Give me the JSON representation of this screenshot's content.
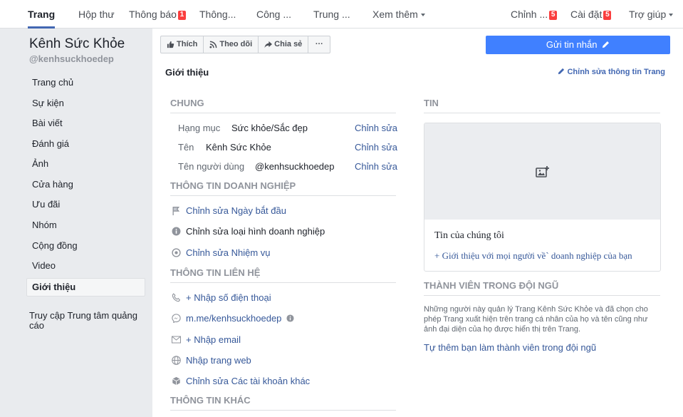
{
  "topnav": {
    "items": [
      {
        "label": "Trang",
        "badge": ""
      },
      {
        "label": "Hộp thư",
        "badge": ""
      },
      {
        "label": "Thông báo",
        "badge": "1"
      },
      {
        "label": "Thông...",
        "badge": ""
      },
      {
        "label": "Công ...",
        "badge": ""
      },
      {
        "label": "Trung ...",
        "badge": ""
      },
      {
        "label": "Xem thêm",
        "badge": ""
      }
    ],
    "right": [
      {
        "label": "Chỉnh ...",
        "badge": "5"
      },
      {
        "label": "Cài đặt",
        "badge": "5"
      },
      {
        "label": "Trợ giúp",
        "badge": ""
      }
    ]
  },
  "sidebar": {
    "page_name": "Kênh Sức Khỏe",
    "page_handle": "@kenhsuckhoedep",
    "items": [
      "Trang chủ",
      "Sự kiện",
      "Bài viết",
      "Đánh giá",
      "Ảnh",
      "Cửa hàng",
      "Ưu đãi",
      "Nhóm",
      "Cộng đồng",
      "Video",
      "Giới thiệu"
    ],
    "active_index": 10,
    "ads_center": "Truy cập Trung tâm quảng cáo"
  },
  "actions": {
    "like": "Thích",
    "follow": "Theo dõi",
    "share": "Chia sẻ",
    "more": "···",
    "send_message": "Gửi tin nhắn"
  },
  "about": {
    "title": "Giới thiệu",
    "edit_page_info": "Chỉnh sửa thông tin Trang",
    "general": {
      "heading": "CHUNG",
      "rows": [
        {
          "label": "Hạng mục",
          "value": "Sức khỏe/Sắc đẹp",
          "edit": "Chỉnh sửa"
        },
        {
          "label": "Tên",
          "value": "Kênh Sức Khỏe",
          "edit": "Chỉnh sửa"
        },
        {
          "label": "Tên người dùng",
          "value": "@kenhsuckhoedep",
          "edit": "Chỉnh sửa"
        }
      ]
    },
    "business": {
      "heading": "THÔNG TIN DOANH NGHIỆP",
      "start_date": "Chỉnh sửa Ngày bắt đầu",
      "business_type": "Chỉnh sửa loại hình doanh nghiệp",
      "mission": "Chỉnh sửa Nhiệm vụ"
    },
    "contact": {
      "heading": "THÔNG TIN LIÊN HỆ",
      "phone": "+ Nhập số điện thoại",
      "messenger": "m.me/kenhsuckhoedep",
      "email": "+ Nhập email",
      "website": "Nhập trang web",
      "other_accounts": "Chỉnh sửa Các tài khoản khác"
    },
    "other": {
      "heading": "THÔNG TIN KHÁC"
    }
  },
  "news": {
    "heading": "TIN",
    "card_title": "Tin của chúng tôi",
    "card_add": "+ Giới thiệu với mọi người về` doanh nghiệp của bạn"
  },
  "team": {
    "heading": "THÀNH VIÊN TRONG ĐỘI NGŨ",
    "description": "Những người này quản lý Trang Kênh Sức Khỏe và đã chọn cho phép Trang xuất hiện trên trang cá nhân của họ và tên cũng như ảnh đại diện của họ được hiển thị trên Trang.",
    "add_self": "Tự thêm bạn làm thành viên trong đội ngũ"
  },
  "colors": {
    "accent": "#4267b2",
    "link": "#365899",
    "send_button": "#4080ff",
    "badge": "#fa3e3e"
  }
}
